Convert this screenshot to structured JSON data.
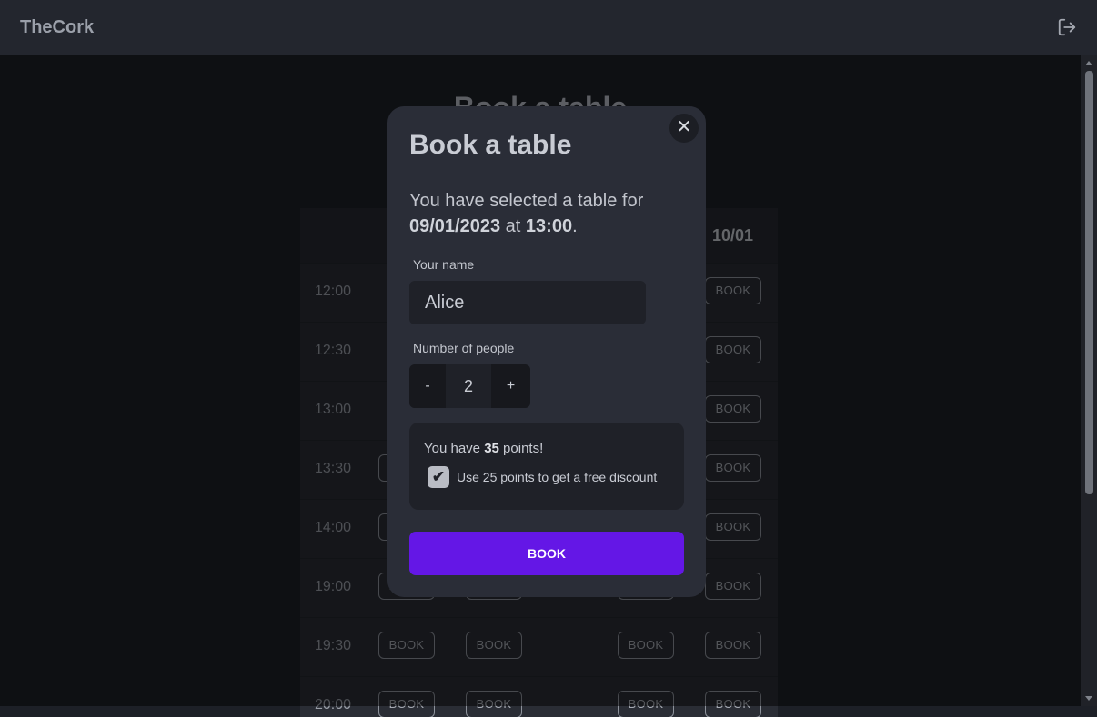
{
  "app": {
    "brand": "TheCork",
    "logout_icon": "logout-icon"
  },
  "background": {
    "title": "Book a table",
    "dates": [
      "10/01"
    ],
    "times": [
      "12:00",
      "12:30",
      "13:00",
      "13:30",
      "14:00",
      "19:00",
      "19:30",
      "20:00"
    ],
    "book_label": "BOOK"
  },
  "modal": {
    "title": "Book a table",
    "desc_prefix": "You have selected a table for",
    "date": "09/01/2023",
    "at": "at",
    "time": "13:00",
    "period": ".",
    "name_label": "Your name",
    "name_value": "Alice",
    "people_label": "Number of people",
    "minus": "-",
    "people_value": "2",
    "plus": "+",
    "points_prefix": "You have",
    "points_value": "35",
    "points_suffix": "points!",
    "discount_label": "Use 25 points to get a free discount",
    "discount_checked": true,
    "book_button": "BOOK",
    "close_icon": "close-icon"
  },
  "colors": {
    "accent": "#6417e6",
    "background": "#1d2027",
    "modal": "#2a2d37"
  }
}
